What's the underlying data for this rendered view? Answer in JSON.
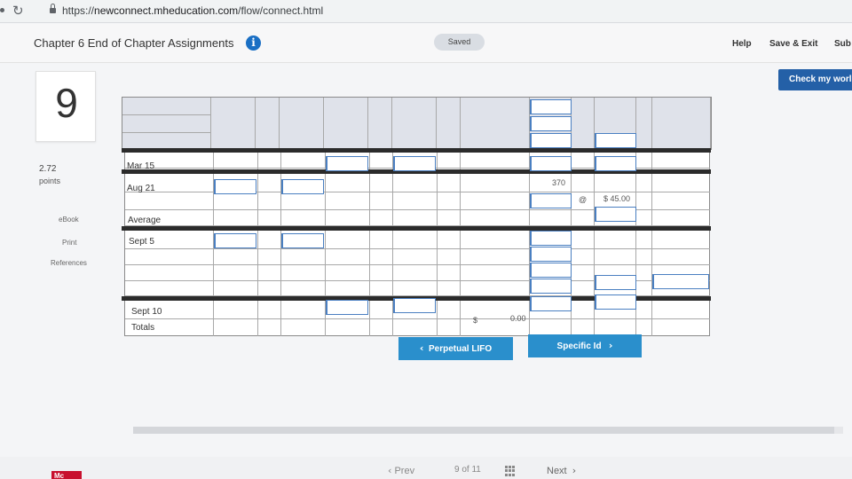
{
  "browser": {
    "url_prefix": "https://",
    "url_host": "newconnect.mheducation.com",
    "url_path": "/flow/connect.html"
  },
  "header": {
    "title": "Chapter 6 End of Chapter Assignments",
    "saved": "Saved",
    "help": "Help",
    "save_exit": "Save & Exit",
    "submit": "Sub"
  },
  "check_work": "Check my worl",
  "question": {
    "number": "9",
    "points_value": "2.72",
    "points_label": "points"
  },
  "sidebar_links": [
    "eBook",
    "Print",
    "References"
  ],
  "table": {
    "rows": {
      "mar15": "Mar 15",
      "aug21": "Aug 21",
      "average": "Average",
      "sept5": "Sept 5",
      "sept10": "Sept 10",
      "totals": "Totals"
    },
    "aug21_units": "370",
    "at_symbol": "@",
    "aug21_cost": "$ 45.00",
    "totals_dollar": "$",
    "totals_value": "0.00"
  },
  "tabs": {
    "prev_label": "Perpetual LIFO",
    "next_label": "Specific Id"
  },
  "footer": {
    "logo": "Mc",
    "prev": "Prev",
    "page_of": "9  of  11",
    "next": "Next"
  }
}
